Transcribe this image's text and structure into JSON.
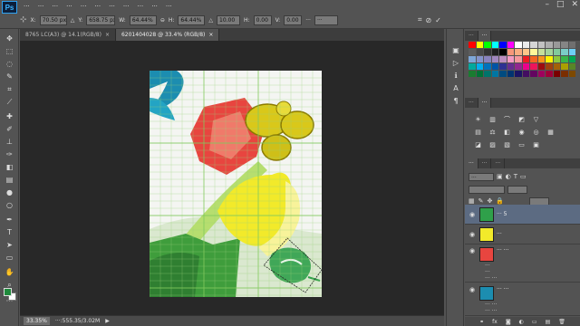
{
  "app": {
    "logo": "Ps",
    "window_controls": [
      "–",
      "□",
      "✕"
    ]
  },
  "menubar": {
    "items": [
      "···",
      "···",
      "···",
      "···",
      "···",
      "···",
      "···",
      "···",
      "···",
      "···",
      "···"
    ]
  },
  "options": {
    "x": "70.50 px",
    "y": "658.75 px",
    "w": "64.44%",
    "h": "64.44%",
    "angle": "10.00",
    "h_skew": "0.00",
    "v_skew": "0.00",
    "interp": "···"
  },
  "tabs": [
    {
      "label": "8765 LC(A3) @ 14.1(RGB/8)",
      "close": "×"
    },
    {
      "label": "6201404028 @ 33.4% (RGB/8)",
      "close": "×"
    }
  ],
  "status": {
    "zoom": "33.35%",
    "doc": "···:555.35/3.02M",
    "arrow": "▶"
  },
  "panels": {
    "top_tabs": [
      "···",
      "···"
    ],
    "adjust_tabs": [
      "···",
      "···"
    ],
    "layers_tabs": [
      "···",
      "···",
      "···"
    ],
    "layers_kind": "···",
    "layers": [
      {
        "name": "··· 5",
        "sub": []
      },
      {
        "name": "···",
        "sub": []
      },
      {
        "name": "··· ···",
        "sub": [
          "···",
          "···",
          "··· ···"
        ]
      },
      {
        "name": "··· ···",
        "sub": [
          "··· ···",
          "··· ···"
        ]
      }
    ],
    "footer": "fx"
  },
  "colors": {
    "bg": "#535353",
    "canvas_bg": "#282828",
    "doc_bg": "#f4f5f2",
    "grid": "#9ad07a",
    "flower": "#e8453f",
    "leaf": "#3f9d3c",
    "yellow": "#f2ea2a"
  }
}
